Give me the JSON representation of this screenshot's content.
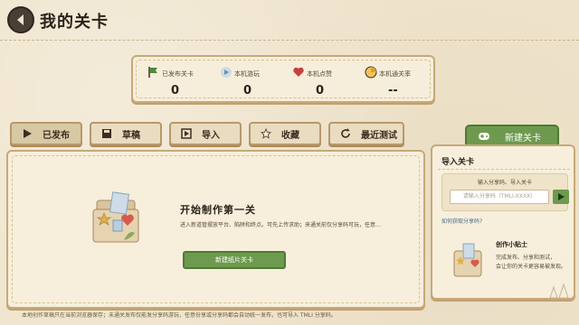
{
  "header": {
    "title": "我的关卡"
  },
  "stats": [
    {
      "label": "已发布关卡",
      "value": "0",
      "icon": "flag-icon",
      "color": "#4e8a3e"
    },
    {
      "label": "本机游玩",
      "value": "0",
      "icon": "play-icon",
      "color": "#6a8fb0"
    },
    {
      "label": "本机点赞",
      "value": "0",
      "icon": "heart-icon",
      "color": "#c84040"
    },
    {
      "label": "本机通关率",
      "value": "--",
      "icon": "pie-icon",
      "color": "#e0a030"
    }
  ],
  "tabs": [
    {
      "label": "已发布",
      "icon": "play-icon"
    },
    {
      "label": "草稿",
      "icon": "save-icon"
    },
    {
      "label": "导入",
      "icon": "import-icon"
    },
    {
      "label": "收藏",
      "icon": "star-icon"
    },
    {
      "label": "最近测试",
      "icon": "refresh-icon"
    }
  ],
  "new_level": {
    "label": "新建关卡",
    "icon": "gamepad-icon"
  },
  "main": {
    "title": "开始制作第一关",
    "desc": "进入新道管摆放平台、陷阱和终点。可先上传求助；来通关前仅分享码可玩，任意…",
    "button": "新建纸片关卡"
  },
  "footer": "本地创作草稿只在当前浏览器保存；未通关发布仅能发分享码游玩，任意份享或分享码都会自动统一发布，也可导入 TMLI 分享码。",
  "side": {
    "title": "导入关卡",
    "box_label": "输入分享码、导入关卡",
    "input_placeholder": "请输入分享码（TMLI-XXXX）",
    "link": "如何获取分享码?",
    "tip_title": "创作小贴士",
    "tip_line1": "完成发布、分享和测试，",
    "tip_line2": "会让你的关卡更容易被发现。"
  },
  "colors": {
    "accent_green": "#6d9a4e",
    "border_tan": "#c7a977",
    "paper": "#efe4cc"
  }
}
